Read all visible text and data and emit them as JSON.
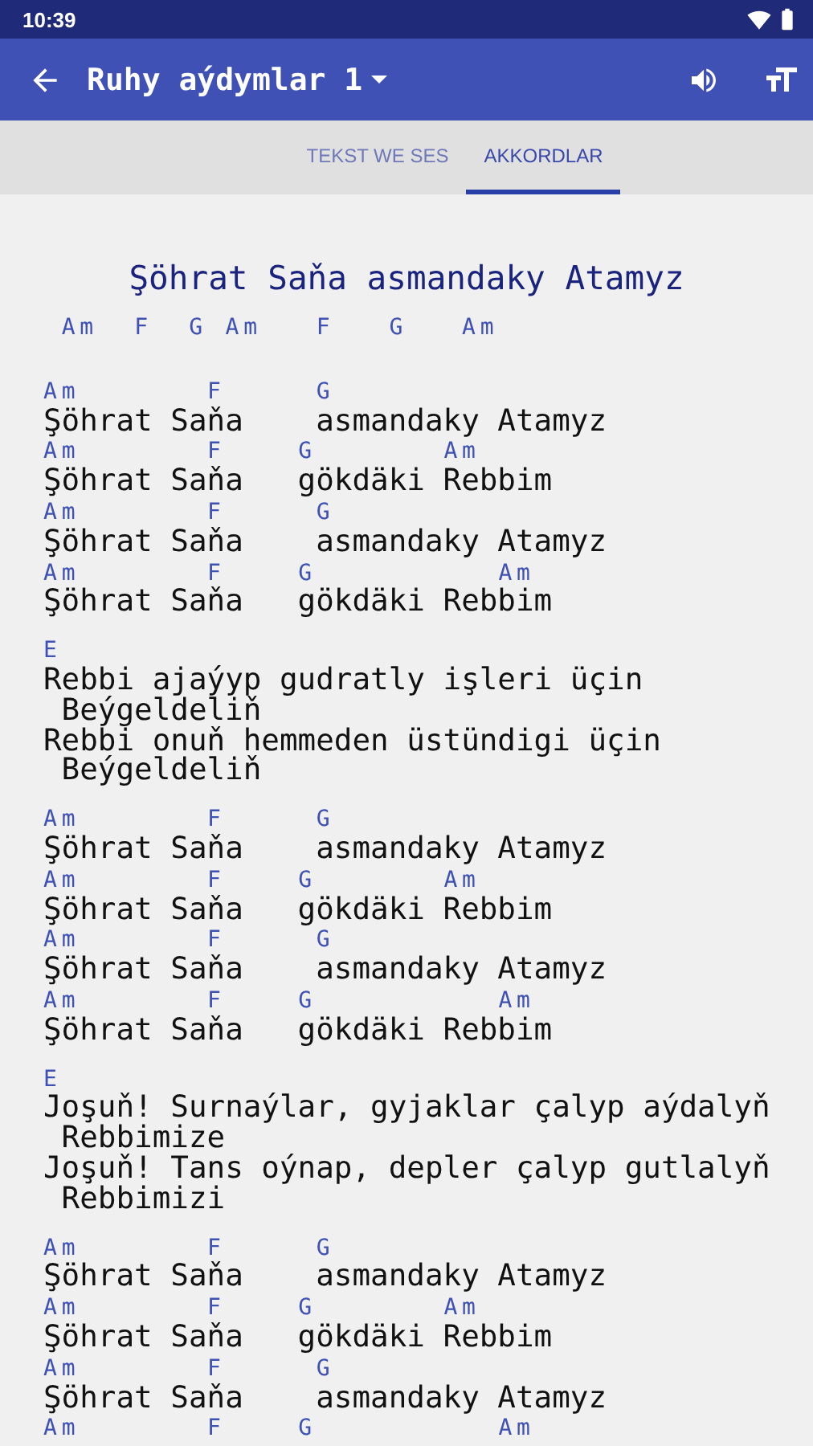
{
  "status_bar": {
    "time": "10:39"
  },
  "app_bar": {
    "title": "Ruhy aýdymlar 1"
  },
  "tabs": [
    {
      "label": "TEKST WE SES",
      "selected": false
    },
    {
      "label": "AKKORDLAR",
      "selected": true
    }
  ],
  "song": {
    "title": "Şöhrat Saňa asmandaky Atamyz",
    "intro": " Am  F  G Am   F   G   Am",
    "sections": [
      {
        "lines": [
          {
            "kind": "chords",
            "text": "Am       F     G"
          },
          {
            "kind": "lyrics",
            "text": "Şöhrat Saňa    asmandaky Atamyz"
          },
          {
            "kind": "chords",
            "text": "Am       F    G       Am"
          },
          {
            "kind": "lyrics",
            "text": "Şöhrat Saňa   gökdäki Rebbim"
          },
          {
            "kind": "chords",
            "text": "Am       F     G"
          },
          {
            "kind": "lyrics",
            "text": "Şöhrat Saňa    asmandaky Atamyz"
          },
          {
            "kind": "chords",
            "text": "Am       F    G          Am"
          },
          {
            "kind": "lyrics",
            "text": "Şöhrat Saňa   gökdäki Rebbim"
          }
        ]
      },
      {
        "lines": [
          {
            "kind": "chords",
            "text": "E"
          },
          {
            "kind": "lyrics",
            "text": "Rebbi ajaýyp gudratly işleri üçin"
          },
          {
            "kind": "wrap",
            "text": "Beýgeldeliň"
          },
          {
            "kind": "lyrics",
            "text": "Rebbi onuň hemmeden üstündigi üçin"
          },
          {
            "kind": "wrap",
            "text": "Beýgeldeliň"
          }
        ]
      },
      {
        "lines": [
          {
            "kind": "chords",
            "text": "Am       F     G"
          },
          {
            "kind": "lyrics",
            "text": "Şöhrat Saňa    asmandaky Atamyz"
          },
          {
            "kind": "chords",
            "text": "Am       F    G       Am"
          },
          {
            "kind": "lyrics",
            "text": "Şöhrat Saňa   gökdäki Rebbim"
          },
          {
            "kind": "chords",
            "text": "Am       F     G"
          },
          {
            "kind": "lyrics",
            "text": "Şöhrat Saňa    asmandaky Atamyz"
          },
          {
            "kind": "chords",
            "text": "Am       F    G          Am"
          },
          {
            "kind": "lyrics",
            "text": "Şöhrat Saňa   gökdäki Rebbim"
          }
        ]
      },
      {
        "lines": [
          {
            "kind": "chords",
            "text": "E"
          },
          {
            "kind": "lyrics",
            "text": "Joşuň! Surnaýlar, gyjaklar çalyp aýdalyň"
          },
          {
            "kind": "wrap",
            "text": "Rebbimize"
          },
          {
            "kind": "lyrics",
            "text": "Joşuň! Tans oýnap, depler çalyp gutlalyň"
          },
          {
            "kind": "wrap",
            "text": "Rebbimizi"
          }
        ]
      },
      {
        "lines": [
          {
            "kind": "chords",
            "text": "Am       F     G"
          },
          {
            "kind": "lyrics",
            "text": "Şöhrat Saňa    asmandaky Atamyz"
          },
          {
            "kind": "chords",
            "text": "Am       F    G       Am"
          },
          {
            "kind": "lyrics",
            "text": "Şöhrat Saňa   gökdäki Rebbim"
          },
          {
            "kind": "chords",
            "text": "Am       F     G"
          },
          {
            "kind": "lyrics",
            "text": "Şöhrat Saňa    asmandaky Atamyz"
          },
          {
            "kind": "chords",
            "text": "Am       F    G          Am"
          }
        ]
      }
    ]
  }
}
